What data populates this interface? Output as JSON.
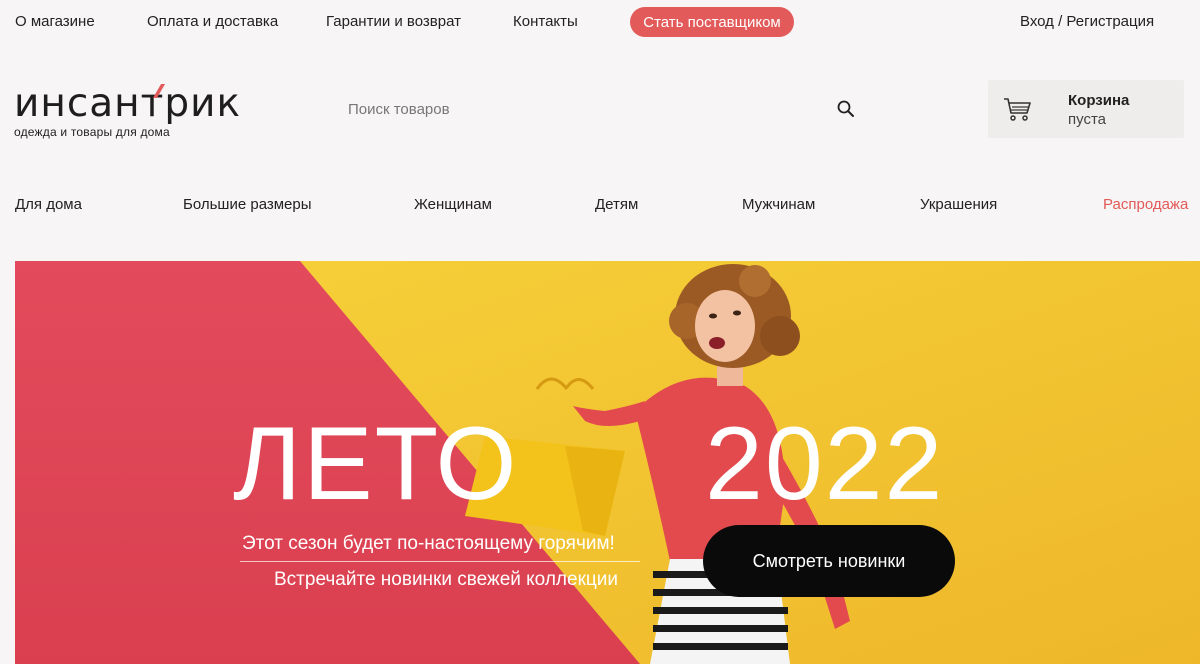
{
  "topbar": {
    "links": [
      "О магазине",
      "Оплата и доставка",
      "Гарантии и возврат",
      "Контакты"
    ],
    "supplier_button": "Стать поставщиком",
    "login": "Вход / Регистрация"
  },
  "logo": {
    "wordmark": "инсантрик",
    "tagline": "одежда и товары для дома"
  },
  "search": {
    "placeholder": "Поиск товаров",
    "icon": "search-icon"
  },
  "cart": {
    "title": "Корзина",
    "status": "пуста",
    "icon": "cart-icon"
  },
  "categories": [
    "Для дома",
    "Большие размеры",
    "Женщинам",
    "Детям",
    "Мужчинам",
    "Украшения",
    "Распродажа"
  ],
  "hero": {
    "word": "ЛЕТО",
    "year": "2022",
    "line1": "Этот сезон будет по-настоящему горячим!",
    "line2": "Встречайте новинки свежей коллекции",
    "button": "Смотреть новинки"
  },
  "colors": {
    "accent": "#e25a59",
    "hero_red": "#e0445a",
    "hero_yellow": "#f2c431",
    "button_dark": "#0a0a0a"
  }
}
